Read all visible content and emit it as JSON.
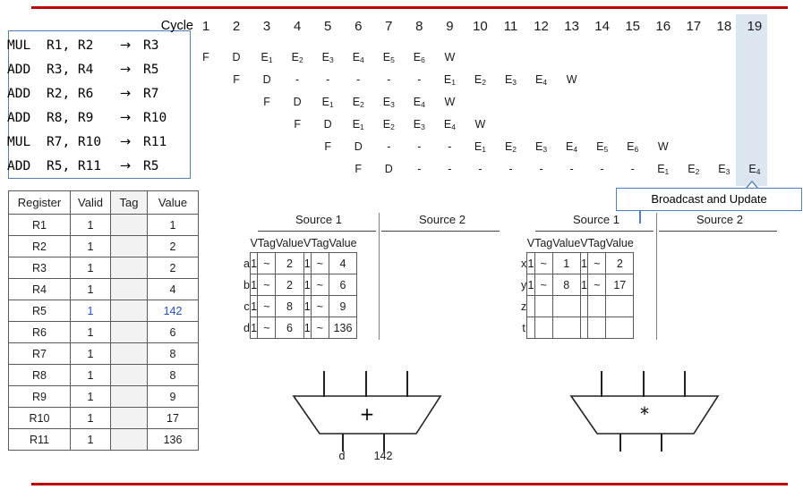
{
  "theme": {
    "rule_color": "#C00000",
    "box_border": "#4F81BD",
    "highlight_col": "#DCE6F1",
    "accent_text": "#1F4EDE"
  },
  "instructions": {
    "rows": [
      {
        "op": "MUL",
        "src": "R1, R2",
        "arrow": "→",
        "dst": "R3"
      },
      {
        "op": "ADD",
        "src": "R3, R4",
        "arrow": "→",
        "dst": "R5"
      },
      {
        "op": "ADD",
        "src": "R2, R6",
        "arrow": "→",
        "dst": "R7"
      },
      {
        "op": "ADD",
        "src": "R8, R9",
        "arrow": "→",
        "dst": "R10"
      },
      {
        "op": "MUL",
        "src": "R7, R10",
        "arrow": "→",
        "dst": "R11"
      },
      {
        "op": "ADD",
        "src": "R5, R11",
        "arrow": "→",
        "dst": "R5"
      }
    ]
  },
  "cycle_chart": {
    "label": "Cycle",
    "cycles": [
      1,
      2,
      3,
      4,
      5,
      6,
      7,
      8,
      9,
      10,
      11,
      12,
      13,
      14,
      15,
      16,
      17,
      18,
      19
    ],
    "highlighted_cycle": 19,
    "rows": [
      [
        "F",
        "D",
        "E1",
        "E2",
        "E3",
        "E4",
        "E5",
        "E6",
        "W",
        "",
        "",
        "",
        "",
        "",
        "",
        "",
        "",
        "",
        ""
      ],
      [
        "",
        "F",
        "D",
        "-",
        "-",
        "-",
        "-",
        "-",
        "E1",
        "E2",
        "E3",
        "E4",
        "W",
        "",
        "",
        "",
        "",
        "",
        ""
      ],
      [
        "",
        "",
        "F",
        "D",
        "E1",
        "E2",
        "E3",
        "E4",
        "W",
        "",
        "",
        "",
        "",
        "",
        "",
        "",
        "",
        "",
        ""
      ],
      [
        "",
        "",
        "",
        "F",
        "D",
        "E1",
        "E2",
        "E3",
        "E4",
        "W",
        "",
        "",
        "",
        "",
        "",
        "",
        "",
        "",
        ""
      ],
      [
        "",
        "",
        "",
        "",
        "F",
        "D",
        "-",
        "-",
        "-",
        "E1",
        "E2",
        "E3",
        "E4",
        "E5",
        "E6",
        "W",
        "",
        "",
        ""
      ],
      [
        "",
        "",
        "",
        "",
        "",
        "F",
        "D",
        "-",
        "-",
        "-",
        "-",
        "-",
        "-",
        "-",
        "-",
        "E1",
        "E2",
        "E3",
        "E4"
      ]
    ]
  },
  "callout": {
    "text": "Broadcast and Update"
  },
  "register_file": {
    "headers": [
      "Register",
      "Valid",
      "Tag",
      "Value"
    ],
    "rows": [
      {
        "register": "R1",
        "valid": "1",
        "tag": "",
        "value": "1",
        "highlight": false
      },
      {
        "register": "R2",
        "valid": "1",
        "tag": "",
        "value": "2",
        "highlight": false
      },
      {
        "register": "R3",
        "valid": "1",
        "tag": "",
        "value": "2",
        "highlight": false
      },
      {
        "register": "R4",
        "valid": "1",
        "tag": "",
        "value": "4",
        "highlight": false
      },
      {
        "register": "R5",
        "valid": "1",
        "tag": "",
        "value": "142",
        "highlight": true
      },
      {
        "register": "R6",
        "valid": "1",
        "tag": "",
        "value": "6",
        "highlight": false
      },
      {
        "register": "R7",
        "valid": "1",
        "tag": "",
        "value": "8",
        "highlight": false
      },
      {
        "register": "R8",
        "valid": "1",
        "tag": "",
        "value": "8",
        "highlight": false
      },
      {
        "register": "R9",
        "valid": "1",
        "tag": "",
        "value": "9",
        "highlight": false
      },
      {
        "register": "R10",
        "valid": "1",
        "tag": "",
        "value": "17",
        "highlight": false
      },
      {
        "register": "R11",
        "valid": "1",
        "tag": "",
        "value": "136",
        "highlight": false
      }
    ]
  },
  "adder_station": {
    "source1_label": "Source 1",
    "source2_label": "Source 2",
    "subheaders": [
      "V",
      "Tag",
      "Value",
      "V",
      "Tag",
      "Value"
    ],
    "rows": [
      {
        "name": "a",
        "s1v": "1",
        "s1tag": "~",
        "s1val": "2",
        "s2v": "1",
        "s2tag": "~",
        "s2val": "4"
      },
      {
        "name": "b",
        "s1v": "1",
        "s1tag": "~",
        "s1val": "2",
        "s2v": "1",
        "s2tag": "~",
        "s2val": "6"
      },
      {
        "name": "c",
        "s1v": "1",
        "s1tag": "~",
        "s1val": "8",
        "s2v": "1",
        "s2tag": "~",
        "s2val": "9"
      },
      {
        "name": "d",
        "s1v": "1",
        "s1tag": "~",
        "s1val": "6",
        "s2v": "1",
        "s2tag": "~",
        "s2val": "136"
      }
    ],
    "unit_symbol": "+",
    "output_tag": "d",
    "output_value": "142"
  },
  "mult_station": {
    "source1_label": "Source 1",
    "source2_label": "Source 2",
    "subheaders": [
      "V",
      "Tag",
      "Value",
      "V",
      "Tag",
      "Value"
    ],
    "rows": [
      {
        "name": "x",
        "s1v": "1",
        "s1tag": "~",
        "s1val": "1",
        "s2v": "1",
        "s2tag": "~",
        "s2val": "2"
      },
      {
        "name": "y",
        "s1v": "1",
        "s1tag": "~",
        "s1val": "8",
        "s2v": "1",
        "s2tag": "~",
        "s2val": "17"
      },
      {
        "name": "z",
        "s1v": "",
        "s1tag": "",
        "s1val": "",
        "s2v": "",
        "s2tag": "",
        "s2val": ""
      },
      {
        "name": "t",
        "s1v": "",
        "s1tag": "",
        "s1val": "",
        "s2v": "",
        "s2tag": "",
        "s2val": ""
      }
    ],
    "unit_symbol": "*",
    "output_tag": "",
    "output_value": ""
  }
}
